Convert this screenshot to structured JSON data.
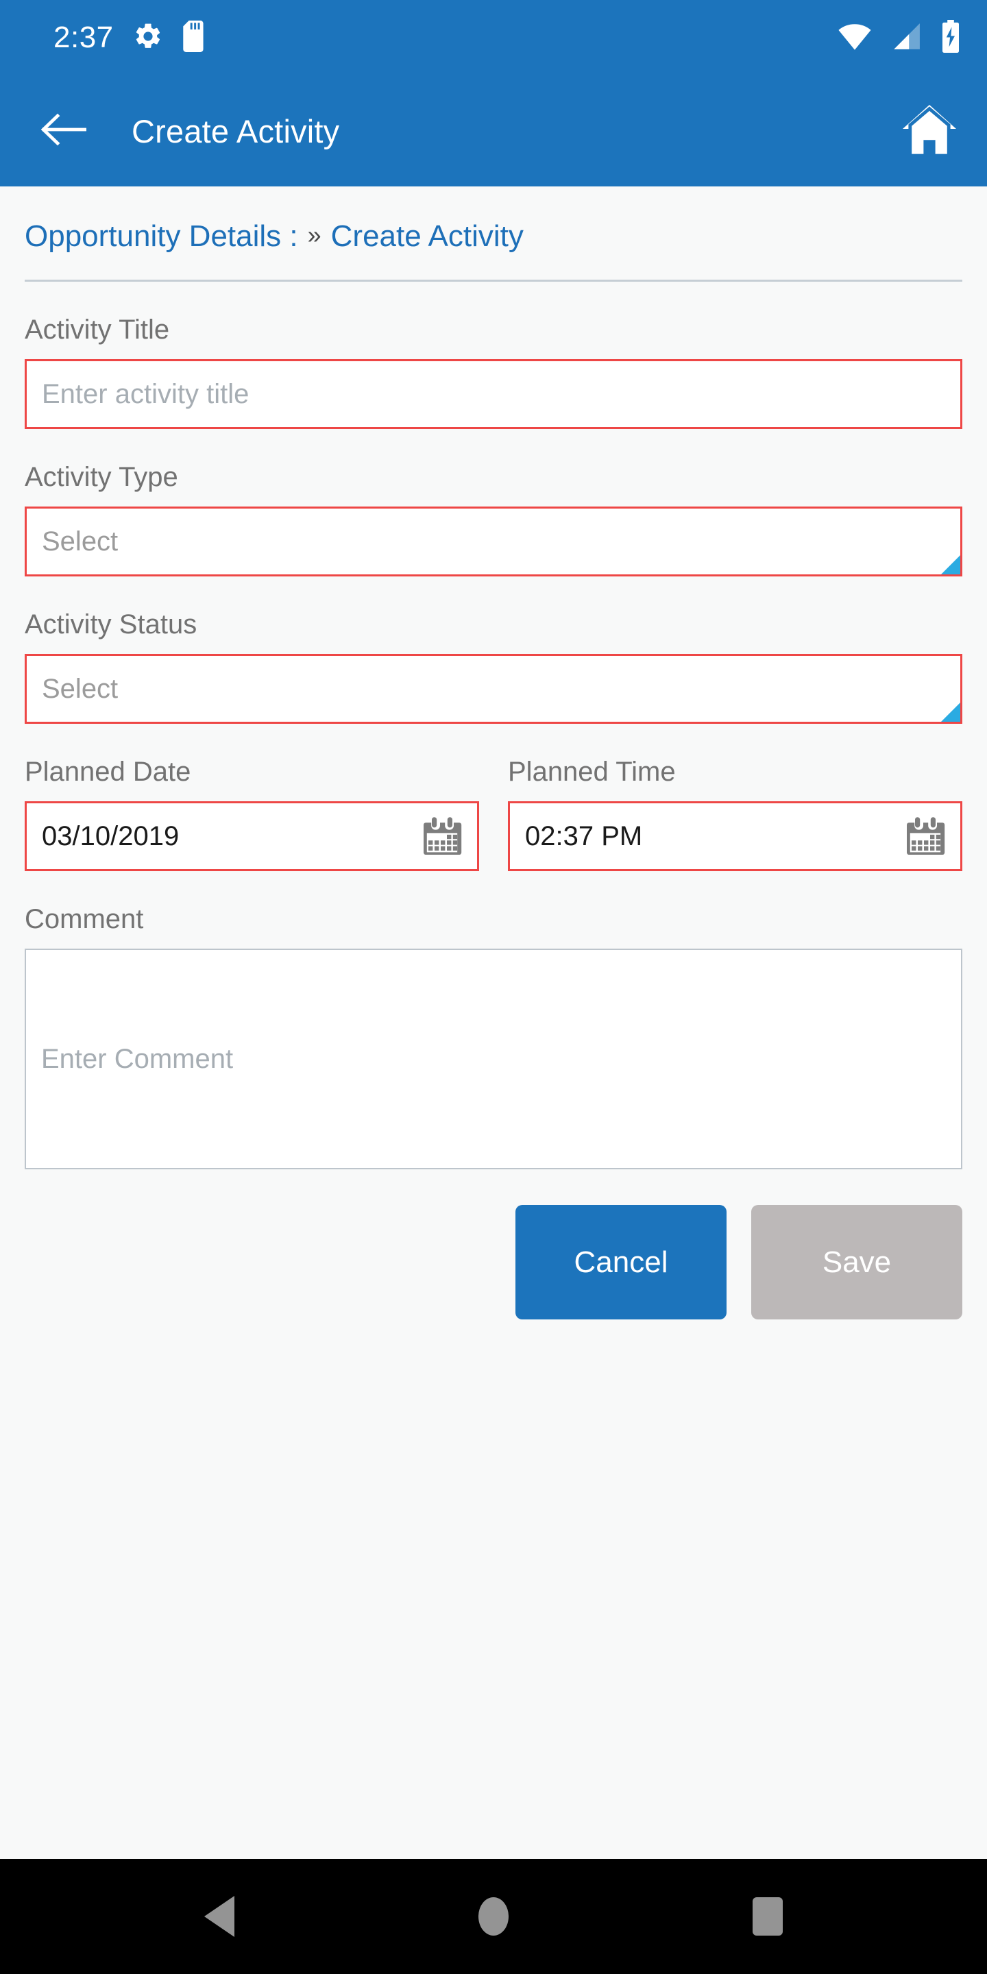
{
  "status_bar": {
    "time": "2:37",
    "icons": [
      "gear-icon",
      "sd-card-icon"
    ],
    "right_icons": [
      "wifi-icon",
      "cellular-signal-icon",
      "battery-charging-icon"
    ]
  },
  "app_bar": {
    "back_icon": "back-arrow-icon",
    "title": "Create Activity",
    "home_icon": "home-icon"
  },
  "breadcrumb": {
    "parent": "Opportunity Details :",
    "separator": "»",
    "current": "Create Activity"
  },
  "form": {
    "activity_title": {
      "label": "Activity Title",
      "value": "",
      "placeholder": "Enter activity title"
    },
    "activity_type": {
      "label": "Activity Type",
      "value": "",
      "placeholder": "Select"
    },
    "activity_status": {
      "label": "Activity Status",
      "value": "",
      "placeholder": "Select"
    },
    "planned_date": {
      "label": "Planned Date",
      "value": "03/10/2019",
      "icon": "calendar-icon"
    },
    "planned_time": {
      "label": "Planned Time",
      "value": "02:37 PM",
      "icon": "calendar-icon"
    },
    "comment": {
      "label": "Comment",
      "value": "",
      "placeholder": "Enter Comment"
    }
  },
  "actions": {
    "cancel_label": "Cancel",
    "save_label": "Save"
  },
  "nav_bar": {
    "back": "nav-back-icon",
    "home": "nav-home-icon",
    "recents": "nav-recents-icon"
  },
  "colors": {
    "primary_blue": "#1c74bc",
    "error_red": "#ee4746",
    "accent_cyan": "#2aabe2",
    "disabled_gray": "#bcb8b8",
    "page_bg": "#f8f9f9"
  }
}
